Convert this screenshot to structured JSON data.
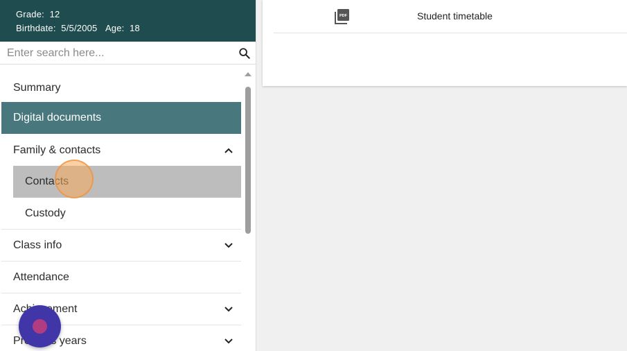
{
  "student": {
    "grade_label": "Grade:",
    "grade_value": "12",
    "birthdate_label": "Birthdate:",
    "birthdate_value": "5/5/2005",
    "age_label": "Age:",
    "age_value": "18"
  },
  "search": {
    "placeholder": "Enter search here...",
    "icon": "search-icon"
  },
  "nav": {
    "summary": "Summary",
    "digital_documents": "Digital documents",
    "family_contacts": "Family & contacts",
    "contacts": "Contacts",
    "custody": "Custody",
    "class_info": "Class info",
    "attendance": "Attendance",
    "achievement": "Achievement",
    "previous_years": "Previous years"
  },
  "documents": [
    {
      "icon": "pdf-icon",
      "name": "Student timetable"
    }
  ],
  "colors": {
    "header_bg": "#1f4c4f",
    "active_item_bg": "#48787d",
    "hover_item_bg": "#bdbdbd",
    "fab": "#4136a8",
    "fab_dot": "#b23c82"
  }
}
